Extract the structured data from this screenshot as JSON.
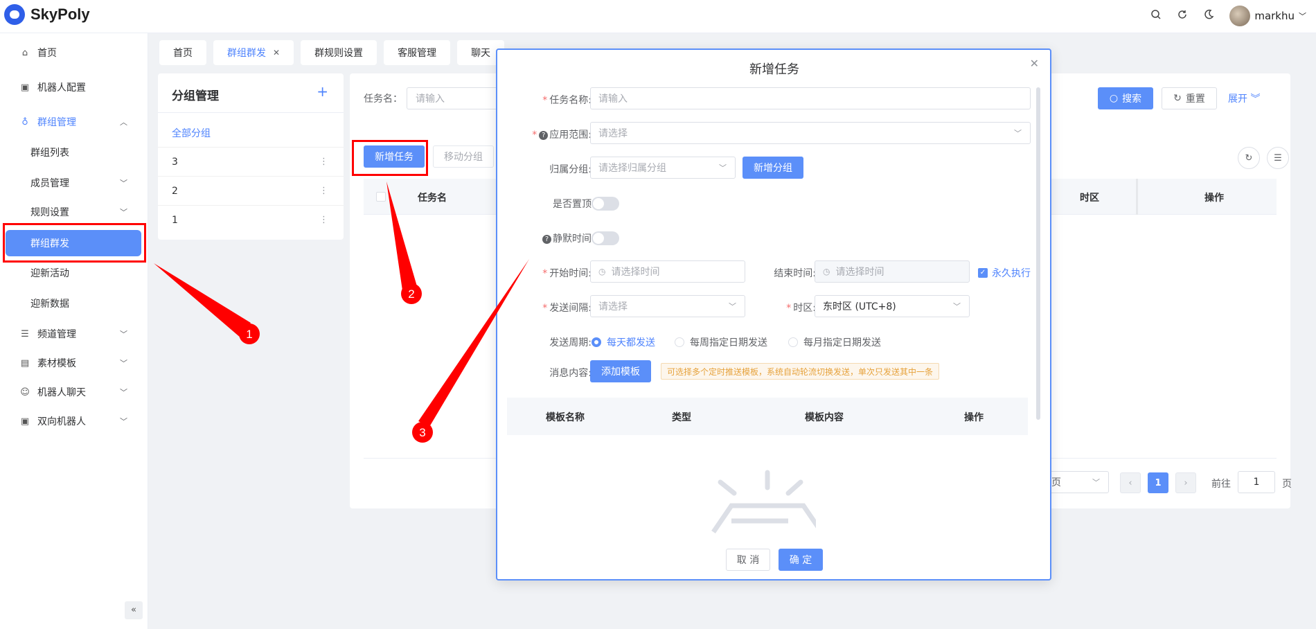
{
  "header": {
    "logo_text": "SkyPoly",
    "icons": [
      "search-icon",
      "refresh-icon",
      "moon-icon"
    ],
    "username": "markhu"
  },
  "sidebar": {
    "items": [
      {
        "label": "首页",
        "icon": "home-icon"
      },
      {
        "label": "机器人配置",
        "icon": "robot-icon"
      },
      {
        "label": "群组管理",
        "icon": "users-icon"
      },
      {
        "label": "群组列表"
      },
      {
        "label": "成员管理"
      },
      {
        "label": "规则设置"
      },
      {
        "label": "群组群发"
      },
      {
        "label": "迎新活动"
      },
      {
        "label": "迎新数据"
      },
      {
        "label": "频道管理",
        "icon": "list-icon"
      },
      {
        "label": "素材模板",
        "icon": "template-icon"
      },
      {
        "label": "机器人聊天",
        "icon": "chat-icon"
      },
      {
        "label": "双向机器人",
        "icon": "bot-icon"
      }
    ],
    "collapse_glyph": "«"
  },
  "tabs": [
    {
      "label": "首页"
    },
    {
      "label": "群组群发"
    },
    {
      "label": "群规则设置"
    },
    {
      "label": "客服管理"
    },
    {
      "label": "聊天"
    }
  ],
  "group_panel": {
    "title": "分组管理",
    "add_glyph": "+",
    "all_label": "全部分组",
    "groups": [
      "3",
      "2",
      "1"
    ]
  },
  "main": {
    "search_label": "任务名：",
    "search_placeholder": "请输入",
    "search_btn": "搜索",
    "reset_btn": "重置",
    "expand_link": "展开",
    "new_task_btn": "新增任务",
    "move_group_btn": "移动分组",
    "table_headers": {
      "name": "任务名",
      "timezone": "时区",
      "action": "操作"
    },
    "pager": {
      "size_suffix": "页",
      "current": "1",
      "goto_label": "前往",
      "goto_value": "1",
      "page_suffix": "页"
    }
  },
  "dialog": {
    "title": "新增任务",
    "task_name_label": "任务名称:",
    "task_name_placeholder": "请输入",
    "scope_label": "应用范围:",
    "scope_placeholder": "请选择",
    "group_label": "归属分组:",
    "group_placeholder": "请选择归属分组",
    "new_group_btn": "新增分组",
    "pin_label": "是否置顶",
    "silent_label": "静默时间",
    "start_label": "开始时间:",
    "start_placeholder": "请选择时间",
    "end_label": "结束时间:",
    "end_placeholder": "请选择时间",
    "forever_label": "永久执行",
    "interval_label": "发送间隔:",
    "interval_placeholder": "请选择",
    "tz_label": "时区:",
    "tz_value": "东时区 (UTC+8)",
    "cycle_label": "发送周期:",
    "cycle_options": [
      "每天都发送",
      "每周指定日期发送",
      "每月指定日期发送"
    ],
    "content_label": "消息内容:",
    "add_template_btn": "添加模板",
    "tip": "可选择多个定时推送模板，系统自动轮流切换发送，单次只发送其中一条",
    "template_headers": [
      "模板名称",
      "类型",
      "模板内容",
      "操作"
    ],
    "cancel_btn": "取 消",
    "confirm_btn": "确 定"
  },
  "annotations": {
    "labels": [
      "1",
      "2",
      "3"
    ],
    "color": "#ff0000"
  }
}
